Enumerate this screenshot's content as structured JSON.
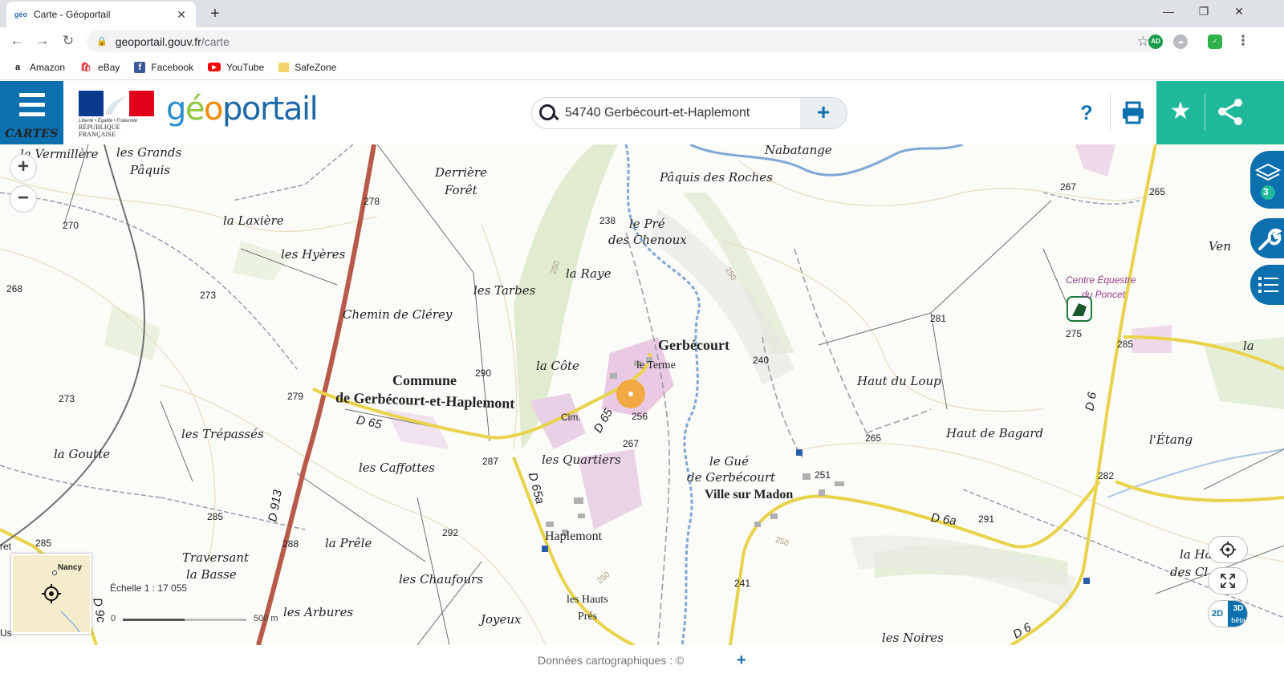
{
  "browser": {
    "tab_title": "Carte - Géoportail",
    "tab_favicon": "géo",
    "url_host": "geoportail.gouv.fr",
    "url_path": "/carte",
    "ext_ad": "AD",
    "bookmarks": [
      {
        "label": "Amazon",
        "icon": "amazon-icon",
        "glyph": "a",
        "color": "#111"
      },
      {
        "label": "eBay",
        "icon": "ebay-icon",
        "glyph": "🛍",
        "color": "#e53238"
      },
      {
        "label": "Facebook",
        "icon": "facebook-icon",
        "glyph": "f",
        "color": "#3b5998"
      },
      {
        "label": "YouTube",
        "icon": "youtube-icon",
        "glyph": "▶",
        "color": "#ff0000"
      },
      {
        "label": "SafeZone",
        "icon": "folder-icon",
        "glyph": "",
        "color": "#f4c542"
      }
    ]
  },
  "header": {
    "menu_label": "CARTES",
    "marianne_devise": "Liberté • Égalité • Fraternité",
    "marianne_rep": "RÉPUBLIQUE FRANÇAISE",
    "logo_parts": [
      "g",
      "é",
      "o",
      "portail"
    ],
    "search_value": "54740 Gerbécourt-et-Haplemont",
    "help": "?",
    "colors": {
      "blue": "#0c6fae",
      "teal": "#1fb89b"
    }
  },
  "map": {
    "labels": {
      "vermillere": "la Vermillère",
      "grands_paquis": "les Grands",
      "grands_paquis2": "Pâquis",
      "derriere": "Derrière",
      "foret": "Forêt",
      "nabatange": "Nabatange",
      "paquis_roches": "Pâquis des Roches",
      "laxiere": "la Laxière",
      "hyeres": "les Hyères",
      "le_pre": "le Pré",
      "chenoux": "des Chenoux",
      "raye": "la Raye",
      "tarbes": "les Tarbes",
      "clerey": "Chemin de Clérey",
      "cote": "la Côte",
      "gerbecourt": "Gerbécourt",
      "terme": "le Terme",
      "commune1": "Commune",
      "commune2": "de Gerbécourt-et-Haplemont",
      "haut_loup": "Haut du Loup",
      "haut_bagard": "Haut de Bagard",
      "etang": "l'Étang",
      "trepasses": "les Trépassés",
      "goutte": "la Goutte",
      "caffottes": "les Caffottes",
      "quartiers": "les Quartiers",
      "gue1": "le Gué",
      "gue2": "de Gerbécourt",
      "ville_madon": "Ville sur Madon",
      "haplemont": "Haplemont",
      "prele": "la Prêle",
      "traversant": "Traversant",
      "basse": "la Basse",
      "chaufours": "les Chaufours",
      "arbures": "les Arbures",
      "joyeux": "Joyeux",
      "hauts": "les Hauts",
      "pres": "Prés",
      "noires": "les Noires",
      "ven": "Ven",
      "la_r": "la",
      "la_ha": "la Ha",
      "des_cl": "des Cl",
      "ret": "ret",
      "us": "Us",
      "cim": "Cim.",
      "centre1": "Centre Équestre",
      "centre2": "du Poncet"
    },
    "roads": {
      "d65_a": "D 65",
      "d65_b": "D 65",
      "d65a": "D 65a",
      "d913": "D 913",
      "d6a": "D 6a",
      "d6_a": "D 6",
      "d6_b": "D 6",
      "d9": "D 9c"
    },
    "spot_heights": [
      "278",
      "270",
      "268",
      "273",
      "273",
      "279",
      "290",
      "287",
      "238",
      "250",
      "256",
      "267",
      "240",
      "250",
      "281",
      "275",
      "285",
      "267",
      "265",
      "265",
      "282",
      "251",
      "291",
      "292",
      "285",
      "288",
      "285",
      "241",
      "250",
      "250"
    ],
    "minimap_label": "Nancy",
    "scale_text": "Échelle 1 : 17 055",
    "scale_start": "0",
    "scale_end": "500 m",
    "layers_count": "3",
    "view_2d": "2D",
    "view_3d": "3D",
    "view_beta": "bêta"
  },
  "footer": {
    "data_label": "Données cartographiques : ©",
    "plus": "+"
  }
}
